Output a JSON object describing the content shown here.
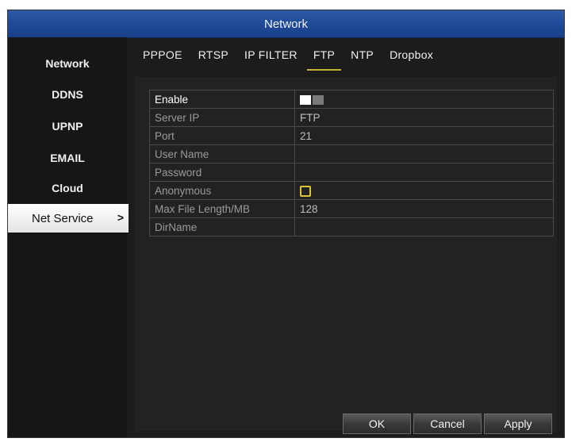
{
  "window": {
    "title": "Network"
  },
  "sidebar": {
    "items": [
      {
        "label": "Network"
      },
      {
        "label": "DDNS"
      },
      {
        "label": "UPNP"
      },
      {
        "label": "EMAIL"
      },
      {
        "label": "Cloud"
      },
      {
        "label": "Net Service",
        "active": true
      }
    ],
    "active_chevron": ">"
  },
  "tabs": [
    {
      "label": "PPPOE"
    },
    {
      "label": "RTSP"
    },
    {
      "label": "IP FILTER"
    },
    {
      "label": "FTP",
      "active": true
    },
    {
      "label": "NTP"
    },
    {
      "label": "Dropbox"
    }
  ],
  "form": {
    "enable": {
      "label": "Enable",
      "value": true
    },
    "server_ip": {
      "label": "Server IP",
      "value": "FTP"
    },
    "port": {
      "label": "Port",
      "value": "21"
    },
    "user_name": {
      "label": "User Name",
      "value": ""
    },
    "password": {
      "label": "Password",
      "value": ""
    },
    "anonymous": {
      "label": "Anonymous",
      "value": false
    },
    "max_file_length": {
      "label": "Max File Length/MB",
      "value": "128"
    },
    "dir_name": {
      "label": "DirName",
      "value": ""
    }
  },
  "buttons": {
    "ok": "OK",
    "cancel": "Cancel",
    "apply": "Apply"
  },
  "colors": {
    "title_bar": "#1f4a98",
    "tab_underline": "#c9b23a",
    "checkbox_border": "#d9c534"
  }
}
